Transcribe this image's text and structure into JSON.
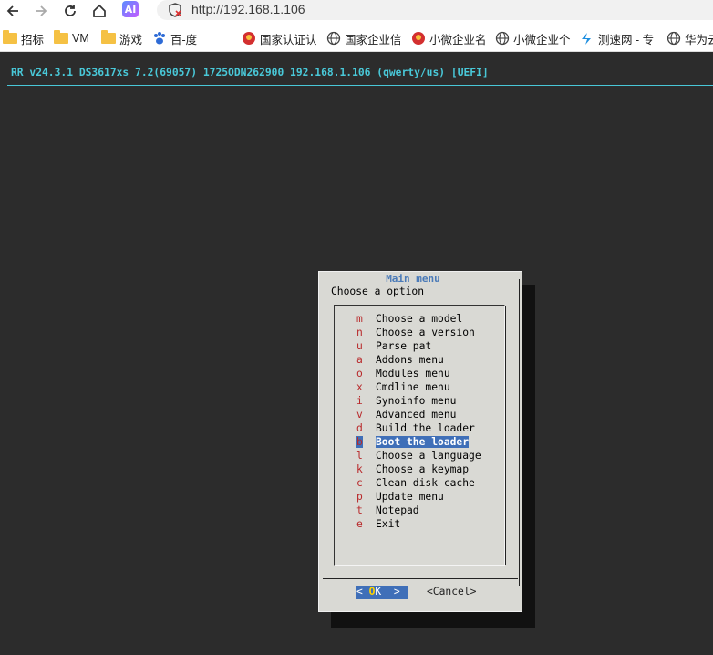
{
  "browser": {
    "url": "http://192.168.1.106",
    "ai_label": "AI",
    "bookmarks": [
      {
        "label": "招标",
        "icon": "folder-icon"
      },
      {
        "label": "VM",
        "icon": "folder-icon"
      },
      {
        "label": "游戏",
        "icon": "folder-icon"
      },
      {
        "label": "百-度",
        "icon": "paw-icon"
      },
      {
        "label": "国家认证认",
        "icon": "emblem-icon"
      },
      {
        "label": "国家企业信",
        "icon": "globe-icon"
      },
      {
        "label": "小微企业名",
        "icon": "emblem-icon"
      },
      {
        "label": "小微企业个",
        "icon": "globe-icon"
      },
      {
        "label": "测速网 - 专",
        "icon": "speed-icon"
      },
      {
        "label": "华为云",
        "icon": "globe-icon"
      }
    ]
  },
  "terminal": {
    "header": "RR v24.3.1 DS3617xs 7.2(69057) 1725ODN262900 192.168.1.106 (qwerty/us) [UEFI]"
  },
  "dialog": {
    "title": "Main menu",
    "prompt": "Choose a option",
    "items": [
      {
        "key": "m",
        "label": "Choose a model"
      },
      {
        "key": "n",
        "label": "Choose a version"
      },
      {
        "key": "u",
        "label": "Parse pat"
      },
      {
        "key": "a",
        "label": "Addons menu"
      },
      {
        "key": "o",
        "label": "Modules menu"
      },
      {
        "key": "x",
        "label": "Cmdline menu"
      },
      {
        "key": "i",
        "label": "Synoinfo menu"
      },
      {
        "key": "v",
        "label": "Advanced menu"
      },
      {
        "key": "d",
        "label": "Build the loader"
      },
      {
        "key": "b",
        "label": "Boot the loader"
      },
      {
        "key": "l",
        "label": "Choose a language"
      },
      {
        "key": "k",
        "label": "Choose a keymap"
      },
      {
        "key": "c",
        "label": "Clean disk cache"
      },
      {
        "key": "p",
        "label": "Update menu"
      },
      {
        "key": "t",
        "label": "Notepad"
      },
      {
        "key": "e",
        "label": "Exit"
      }
    ],
    "selected_index": 9,
    "ok_button": {
      "left": "< ",
      "hotkey": "O",
      "rest": "K",
      "right": "  >"
    },
    "cancel_button": "<Cancel>"
  },
  "colors": {
    "terminal_bg": "#2c2c2c",
    "header_text": "#49c8d8",
    "dialog_bg": "#d9d9d4",
    "selection": "#3f6fb8",
    "hotkey_red": "#b8282a"
  }
}
